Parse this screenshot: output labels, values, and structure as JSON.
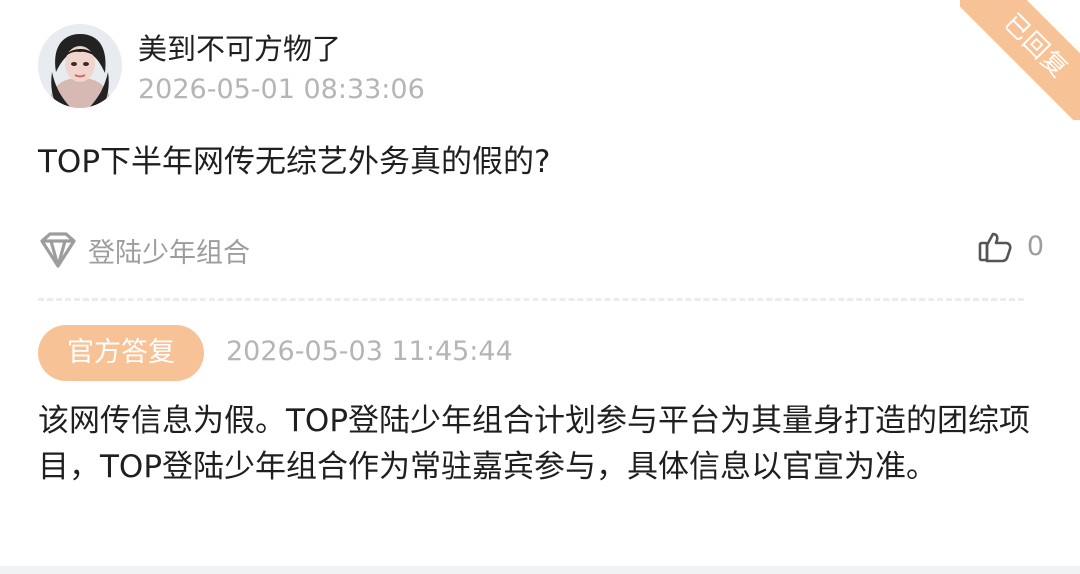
{
  "ribbon": {
    "label": "已回复"
  },
  "post": {
    "user_name": "美到不可方物了",
    "time": "2026-05-01 08:33:06",
    "question": "TOP下半年网传无综艺外务真的假的?",
    "topic_icon": "diamond-icon",
    "topic_label": "登陆少年组合",
    "like_icon": "thumbs-up-icon",
    "like_count": "0"
  },
  "reply": {
    "badge_label": "官方答复",
    "time": "2026-05-03 11:45:44",
    "text": "该网传信息为假。TOP登陆少年组合计划参与平台为其量身打造的团综项目，TOP登陆少年组合作为常驻嘉宾参与，具体信息以官宣为准。"
  },
  "colors": {
    "accent": "#f7c396",
    "text_primary": "#1f1f1f",
    "text_secondary": "#9d9d9d",
    "time_gray": "#b5b5b5",
    "divider": "#ececec"
  }
}
